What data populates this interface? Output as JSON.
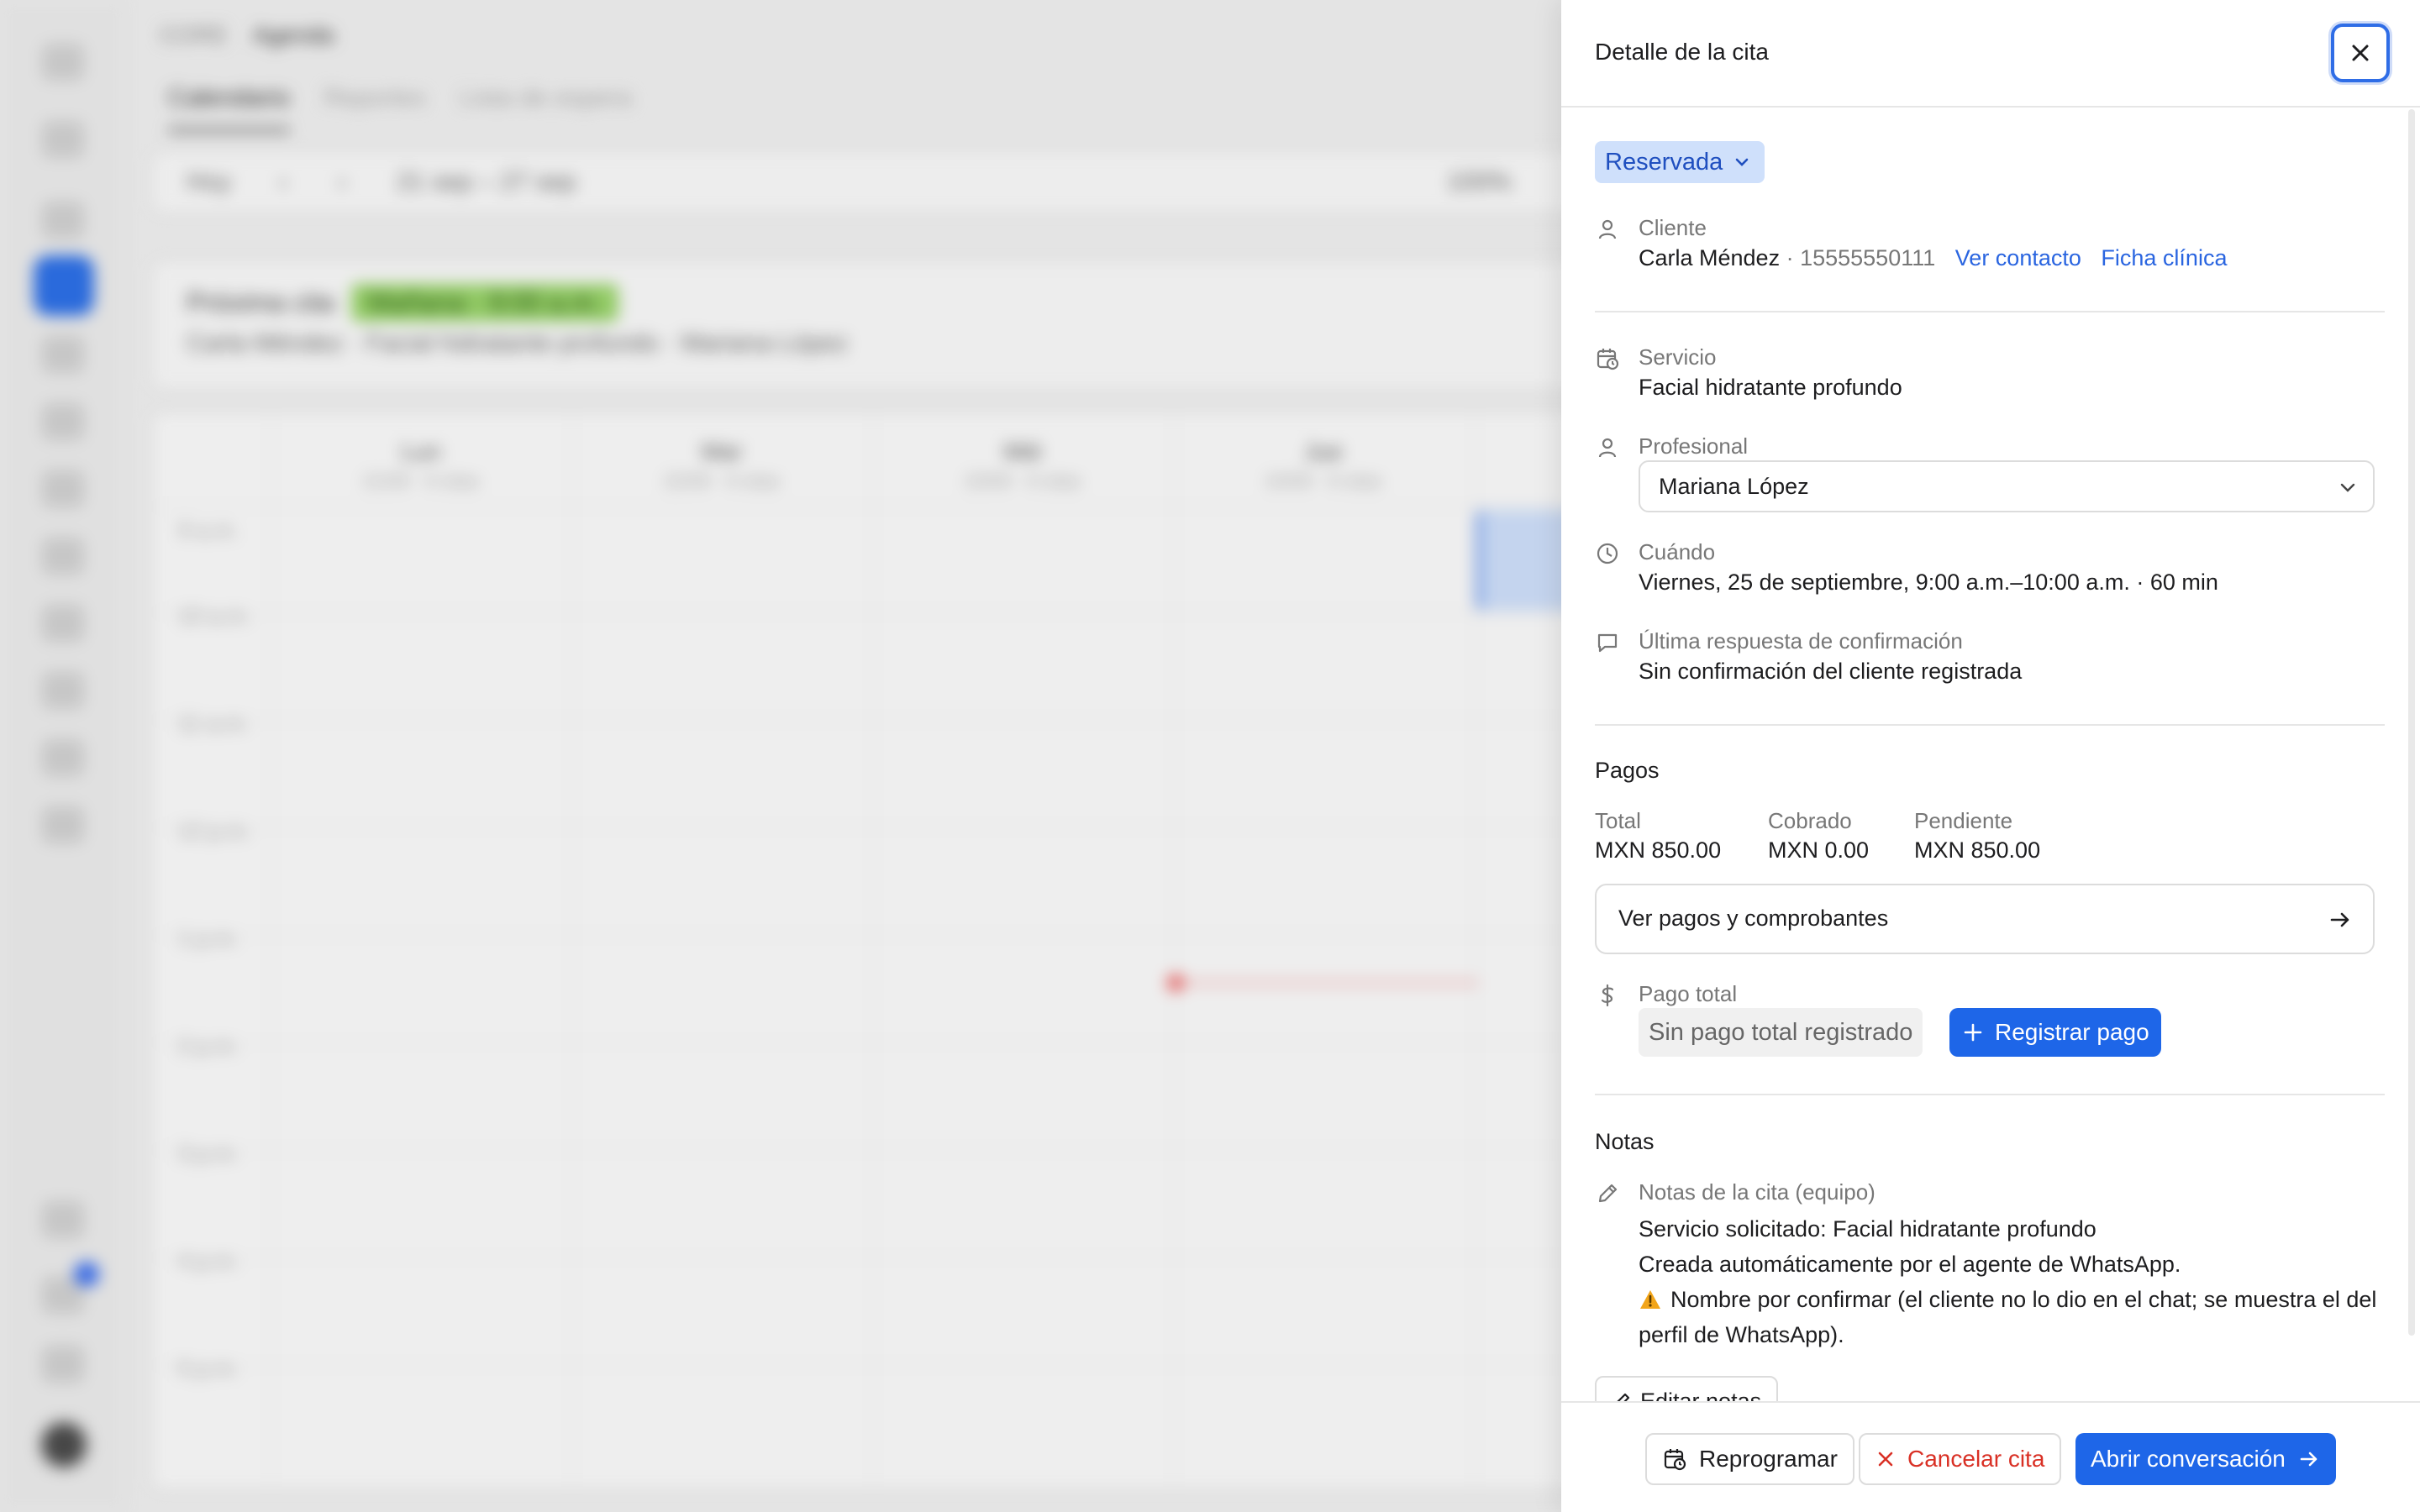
{
  "background": {
    "breadcrumb": [
      "CORE",
      "Agenda"
    ],
    "tabs": [
      "Calendario",
      "Reportes",
      "Lista de espera"
    ],
    "toolbar": {
      "today": "Hoy",
      "prev": "‹",
      "next": "›",
      "range": "21 sep – 27 sep",
      "zoom": "100%"
    },
    "next_appointment": {
      "title": "Próxima cita",
      "badge": "Mañana · 9:00 a.m.",
      "detail": "Carla Méndez · Facial hidratante profundo · Mariana López"
    },
    "days": [
      {
        "name": "Lun",
        "sub": "21/09 · 0 citas"
      },
      {
        "name": "Mar",
        "sub": "22/09 · 0 citas"
      },
      {
        "name": "Mié",
        "sub": "23/09 · 0 citas"
      },
      {
        "name": "Jue",
        "sub": "24/09 · 0 citas"
      }
    ],
    "times": [
      "9 a.m.",
      "10 a.m.",
      "11 a.m.",
      "12 p.m.",
      "1 p.m.",
      "2 p.m.",
      "3 p.m.",
      "4 p.m.",
      "5 p.m."
    ]
  },
  "drawer": {
    "title": "Detalle de la cita",
    "status": "Reservada",
    "client": {
      "label": "Cliente",
      "name": "Carla Méndez",
      "phone": "· 15555550111",
      "view_contact": "Ver contacto",
      "clinical_file": "Ficha clínica"
    },
    "service": {
      "label": "Servicio",
      "value": "Facial hidratante profundo"
    },
    "professional": {
      "label": "Profesional",
      "value": "Mariana López"
    },
    "when": {
      "label": "Cuándo",
      "value": "Viernes, 25 de septiembre, 9:00 a.m.–10:00 a.m. · 60 min"
    },
    "confirmation": {
      "label": "Última respuesta de confirmación",
      "value": "Sin confirmación del cliente registrada"
    },
    "payments": {
      "title": "Pagos",
      "total_label": "Total",
      "total_value": "MXN 850.00",
      "collected_label": "Cobrado",
      "collected_value": "MXN 0.00",
      "pending_label": "Pendiente",
      "pending_value": "MXN 850.00",
      "view_button": "Ver pagos y comprobantes",
      "full_payment_label": "Pago total",
      "full_payment_status": "Sin pago total registrado",
      "register_button": "Registrar pago"
    },
    "notes": {
      "title": "Notas",
      "label": "Notas de la cita (equipo)",
      "line1": "Servicio solicitado: Facial hidratante profundo",
      "line2": "Creada automáticamente por el agente de WhatsApp.",
      "line3": "Nombre por confirmar (el cliente no lo dio en el chat; se muestra el del perfil de WhatsApp).",
      "edit_button": "Editar notas"
    },
    "footer": {
      "reschedule": "Reprogramar",
      "cancel": "Cancelar cita",
      "open_chat": "Abrir conversación"
    }
  },
  "colors": {
    "accent": "#1e66e8",
    "status_bg": "#cfe0fb",
    "danger": "#d93025",
    "warning": "#f2a51a"
  }
}
